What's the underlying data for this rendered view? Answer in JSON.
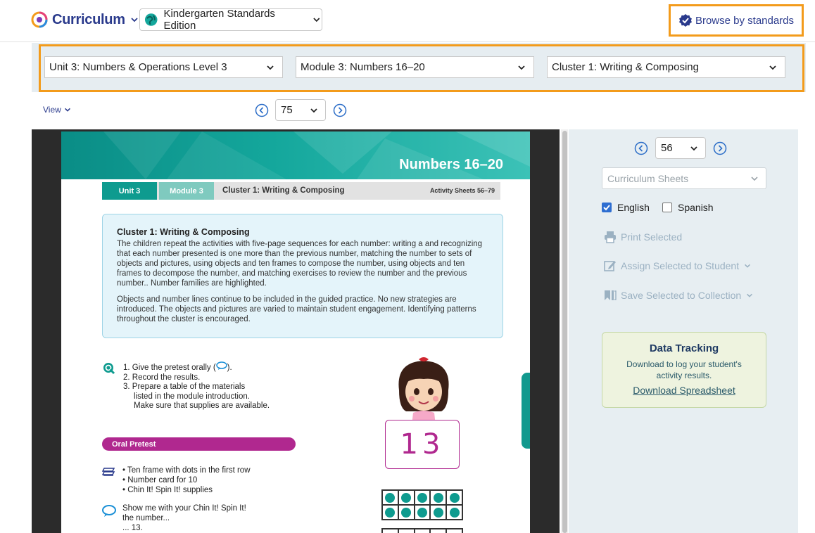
{
  "topbar": {
    "brand": "Curriculum",
    "edition": "Kindergarten Standards Edition",
    "browse": "Browse by standards"
  },
  "selectors": {
    "unit": "Unit 3: Numbers & Operations Level 3",
    "module": "Module 3: Numbers 16–20",
    "cluster": "Cluster 1: Writing & Composing"
  },
  "viewer": {
    "view_label": "View",
    "page": "75"
  },
  "document": {
    "banner_title": "Numbers 16–20",
    "tab_unit": "Unit 3",
    "tab_module": "Module 3",
    "tab_cluster": "Cluster 1: Writing & Composing",
    "tab_activity": "Activity Sheets 56–79",
    "info_heading": "Cluster 1: Writing & Composing",
    "info_p1": "The children repeat the activities with five-page sequences for each number: writing a and recognizing that each number presented is one more than the previous number, matching the number to sets of objects and pictures, using objects and ten frames to compose the number, using objects and ten frames to decompose the number,  and matching exercises to review the number and the previous number.. Number families are highlighted.",
    "info_p2": "Objects and number lines continue to be included in the guided practice. No new strategies are introduced. The objects and pictures are varied to maintain student engagement. Identifying patterns throughout the cluster is encouraged.",
    "step1": "1. Give the pretest orally (",
    "step1_end": ").",
    "step2": "2. Record the results.",
    "step3a": "3. Prepare a table of the materials",
    "step3b": "listed in the module introduction.",
    "step3c": "Make sure that supplies are available.",
    "oral_pretest": "Oral Pretest",
    "material1": "• Ten frame with dots in the first row",
    "material2": "• Number card for 10",
    "material3": "• Chin It! Spin It! supplies",
    "show_me": "Show me with your Chin It! Spin It!\nthe number...\n... 13.",
    "number_card": "13"
  },
  "panel": {
    "page": "56",
    "sheet_select": "Curriculum Sheets",
    "english": "English",
    "spanish": "Spanish",
    "print": "Print Selected",
    "assign": "Assign Selected to Student",
    "save": "Save Selected to Collection",
    "dt_title": "Data Tracking",
    "dt_desc": "Download to log your student's activity results.",
    "dt_link": "Download Spreadsheet"
  },
  "colors": {
    "brand_blue": "#2a3a8c",
    "highlight_orange": "#f39b1b",
    "teal": "#0e9b8f",
    "magenta": "#b0288f"
  }
}
